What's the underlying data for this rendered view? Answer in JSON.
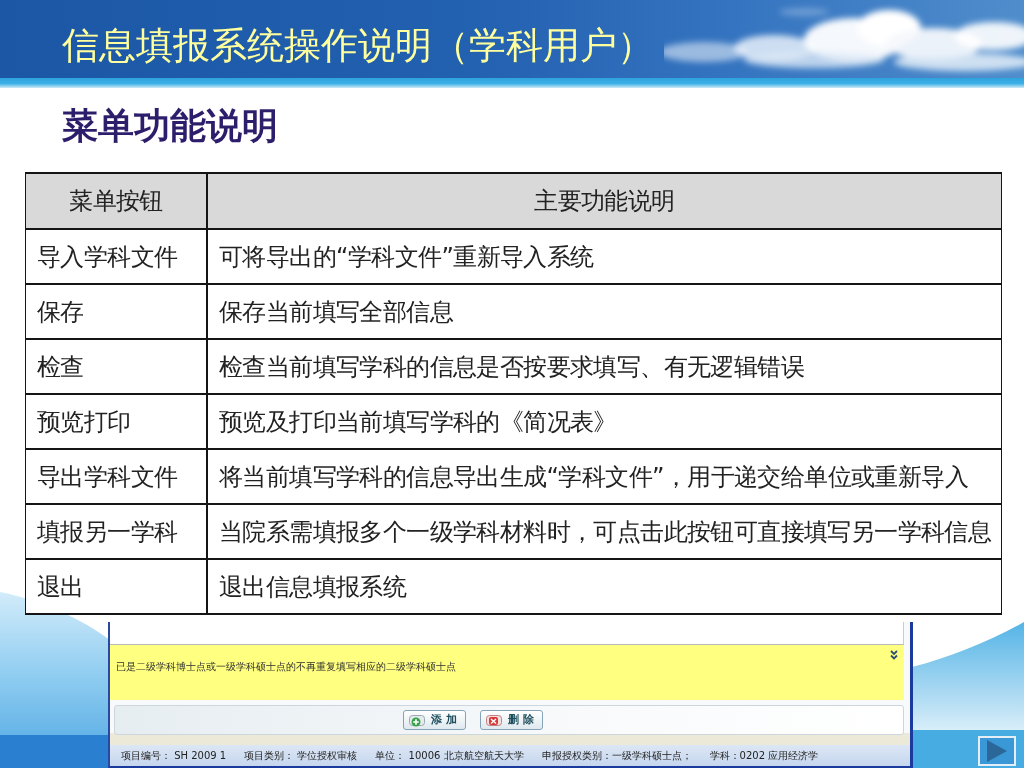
{
  "header": {
    "title": "信息填报系统操作说明（学科用户）"
  },
  "section_title": "菜单功能说明",
  "table": {
    "columns": [
      "菜单按钮",
      "主要功能说明"
    ],
    "rows": [
      {
        "button": "导入学科文件",
        "description": "可将导出的“学科文件”重新导入系统"
      },
      {
        "button": "保存",
        "description": "保存当前填写全部信息"
      },
      {
        "button": "检查",
        "description": "检查当前填写学科的信息是否按要求填写、有无逻辑错误"
      },
      {
        "button": "预览打印",
        "description": "预览及打印当前填写学科的《简况表》"
      },
      {
        "button": "导出学科文件",
        "description": "将当前填写学科的信息导出生成“学科文件”，用于递交给单位或重新导入"
      },
      {
        "button": "填报另一学科",
        "description": "当院系需填报多个一级学科材料时，可点击此按钮可直接填写另一学科信息"
      },
      {
        "button": "退出",
        "description": "退出信息填报系统"
      }
    ]
  },
  "app_window": {
    "notice": "已是二级学科博士点或一级学科硕士点的不再重复填写相应的二级学科硕士点",
    "buttons": [
      {
        "label": "添 加",
        "kind": "add"
      },
      {
        "label": "删 除",
        "kind": "delete"
      }
    ],
    "status_bar": [
      "项目编号： SH 2009 1",
      "项目类别： 学位授权审核",
      "单位： 10006 北京航空航天大学",
      "申报授权类别：一级学科硕士点；",
      "学科：0202 应用经济学"
    ]
  }
}
